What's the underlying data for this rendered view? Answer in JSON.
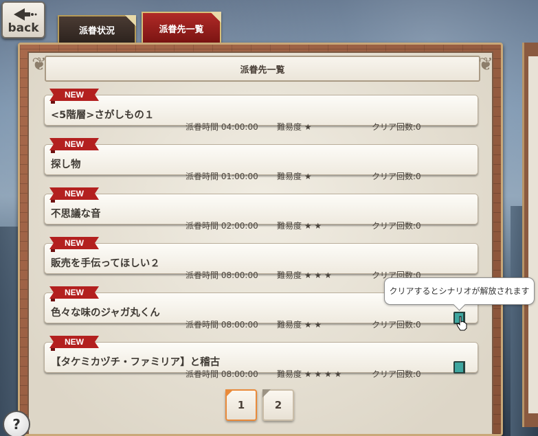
{
  "nav": {
    "back_label": "back",
    "tabs": [
      {
        "label": "派眷状況",
        "active": false
      },
      {
        "label": "派眷先一覧",
        "active": true
      }
    ]
  },
  "panel": {
    "title": "派眷先一覧"
  },
  "missions": [
    {
      "badge": "NEW",
      "title": "<5階層>さがしもの１",
      "time": "派眷時間 04:00:00",
      "difficulty": "難易度 ★",
      "clears": "クリア回数:0",
      "book": false
    },
    {
      "badge": "NEW",
      "title": "探し物",
      "time": "派眷時間 01:00:00",
      "difficulty": "難易度 ★",
      "clears": "クリア回数:0",
      "book": false
    },
    {
      "badge": "NEW",
      "title": "不思議な音",
      "time": "派眷時間 02:00:00",
      "difficulty": "難易度 ★ ★",
      "clears": "クリア回数:0",
      "book": false
    },
    {
      "badge": "NEW",
      "title": "販売を手伝ってほしい２",
      "time": "派眷時間 08:00:00",
      "difficulty": "難易度 ★ ★ ★",
      "clears": "クリア回数:0",
      "book": false
    },
    {
      "badge": "NEW",
      "title": "色々な味のジャガ丸くん",
      "time": "派眷時間 08:00:00",
      "difficulty": "難易度 ★ ★",
      "clears": "クリア回数:0",
      "book": true
    },
    {
      "badge": "NEW",
      "title": "【タケミカヅチ・ファミリア】と稽古",
      "time": "派眷時間 08:00:00",
      "difficulty": "難易度 ★ ★ ★ ★",
      "clears": "クリア回数:0",
      "book": true
    }
  ],
  "tooltip": {
    "text": "クリアするとシナリオが解放されます"
  },
  "pagination": {
    "pages": [
      "1",
      "2"
    ],
    "current": "1"
  },
  "help": {
    "label": "?"
  },
  "colors": {
    "badge_red": "#b3201f",
    "book_teal": "#3fa69f",
    "tab_active": "#b02a27",
    "tab_inactive": "#3a2d26",
    "page_active_border": "#e98a3a"
  }
}
